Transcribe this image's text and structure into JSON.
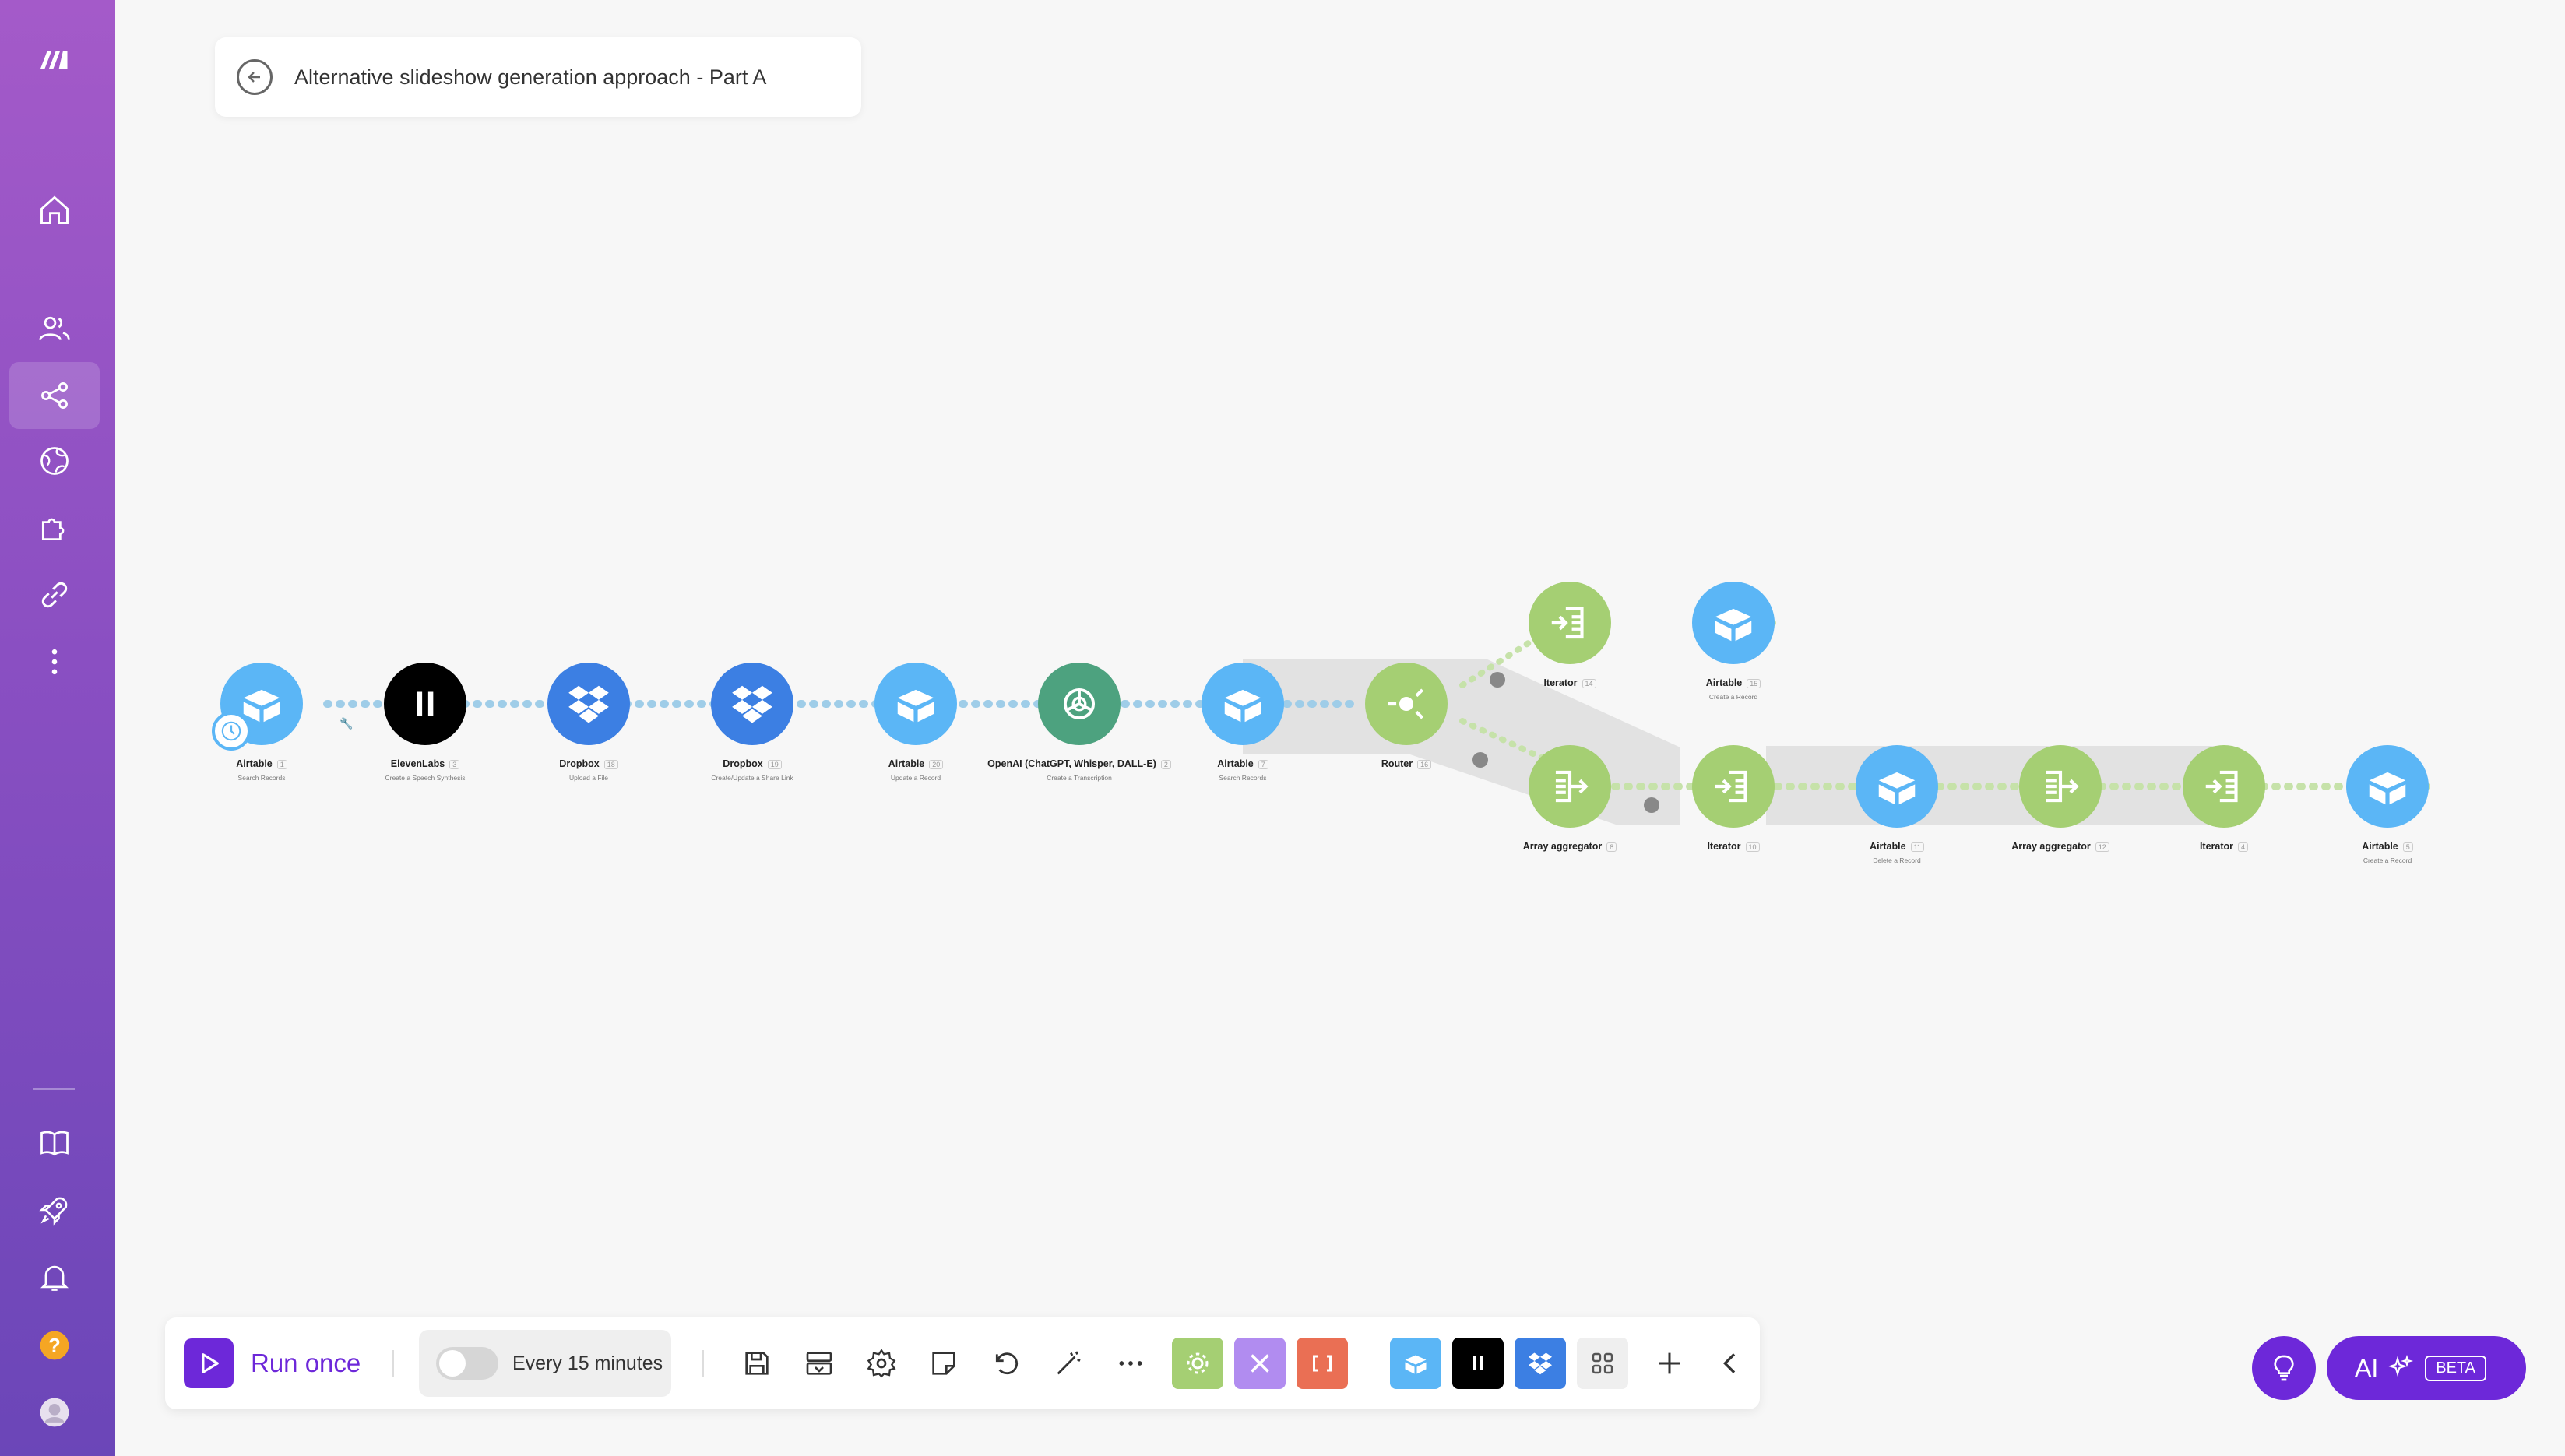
{
  "scenario": {
    "title": "Alternative slideshow generation approach - Part A",
    "back_icon": "back-arrow-icon"
  },
  "sidebar": {
    "logo_icon": "make-logo-icon",
    "items": [
      {
        "name": "home",
        "icon": "home-icon"
      },
      {
        "name": "teams",
        "icon": "users-icon"
      },
      {
        "name": "scenarios",
        "icon": "share-icon",
        "active": true
      },
      {
        "name": "templates",
        "icon": "globe-icon"
      },
      {
        "name": "apps",
        "icon": "puzzle-icon"
      },
      {
        "name": "connections",
        "icon": "link-icon"
      },
      {
        "name": "more",
        "icon": "more-vertical-icon"
      },
      {
        "name": "docs",
        "icon": "book-icon"
      },
      {
        "name": "resources",
        "icon": "rocket-icon"
      },
      {
        "name": "notifications",
        "icon": "bell-icon"
      },
      {
        "name": "help",
        "icon": "help-icon"
      },
      {
        "name": "profile",
        "icon": "avatar-icon"
      }
    ]
  },
  "modules": [
    {
      "id": "m1",
      "app": "Airtable",
      "num": "1",
      "action": "Search Records"
    },
    {
      "id": "m2",
      "app": "ElevenLabs",
      "num": "3",
      "action": "Create a Speech Synthesis"
    },
    {
      "id": "m3",
      "app": "Dropbox",
      "num": "18",
      "action": "Upload a File"
    },
    {
      "id": "m4",
      "app": "Dropbox",
      "num": "19",
      "action": "Create/Update a Share Link"
    },
    {
      "id": "m5",
      "app": "Airtable",
      "num": "20",
      "action": "Update a Record"
    },
    {
      "id": "m6",
      "app": "OpenAI (ChatGPT, Whisper, DALL-E)",
      "num": "2",
      "action": "Create a Transcription"
    },
    {
      "id": "m7",
      "app": "Airtable",
      "num": "7",
      "action": "Search Records"
    },
    {
      "id": "m8",
      "app": "Router",
      "num": "16",
      "action": ""
    },
    {
      "id": "m9",
      "app": "Iterator",
      "num": "14",
      "action": ""
    },
    {
      "id": "m10",
      "app": "Airtable",
      "num": "15",
      "action": "Create a Record"
    },
    {
      "id": "m11",
      "app": "Array aggregator",
      "num": "8",
      "action": ""
    },
    {
      "id": "m12",
      "app": "Iterator",
      "num": "10",
      "action": ""
    },
    {
      "id": "m13",
      "app": "Airtable",
      "num": "11",
      "action": "Delete a Record"
    },
    {
      "id": "m14",
      "app": "Array aggregator",
      "num": "12",
      "action": ""
    },
    {
      "id": "m15",
      "app": "Iterator",
      "num": "4",
      "action": ""
    },
    {
      "id": "m16",
      "app": "Airtable",
      "num": "5",
      "action": "Create a Record"
    }
  ],
  "toolbar": {
    "run_label": "Run once",
    "schedule_label": "Every 15 minutes",
    "schedule_enabled": false,
    "tools": [
      "save-icon",
      "import-export-icon",
      "settings-icon",
      "notes-icon",
      "undo-icon",
      "auto-align-icon",
      "more-icon"
    ],
    "tiles": [
      {
        "name": "tools",
        "color": "#a5cf73"
      },
      {
        "name": "flow-control",
        "color": "#b18cf0"
      },
      {
        "name": "text-parser",
        "color": "#ea6f54"
      },
      {
        "name": "airtable",
        "color": "#5bb6f6"
      },
      {
        "name": "elevenlabs",
        "color": "#000000"
      },
      {
        "name": "dropbox",
        "color": "#3c7fe3"
      },
      {
        "name": "all-apps",
        "color": "#efefef"
      }
    ]
  },
  "ai_assistant": {
    "label": "AI",
    "badge": "BETA"
  },
  "colors": {
    "sidebar_top": "#a45ac9",
    "sidebar_bottom": "#6b46b8",
    "accent": "#6d28d9",
    "airtable": "#5bb6f6",
    "dropbox": "#3c7fe3",
    "openai": "#4da27f",
    "flow": "#a5cf73"
  }
}
